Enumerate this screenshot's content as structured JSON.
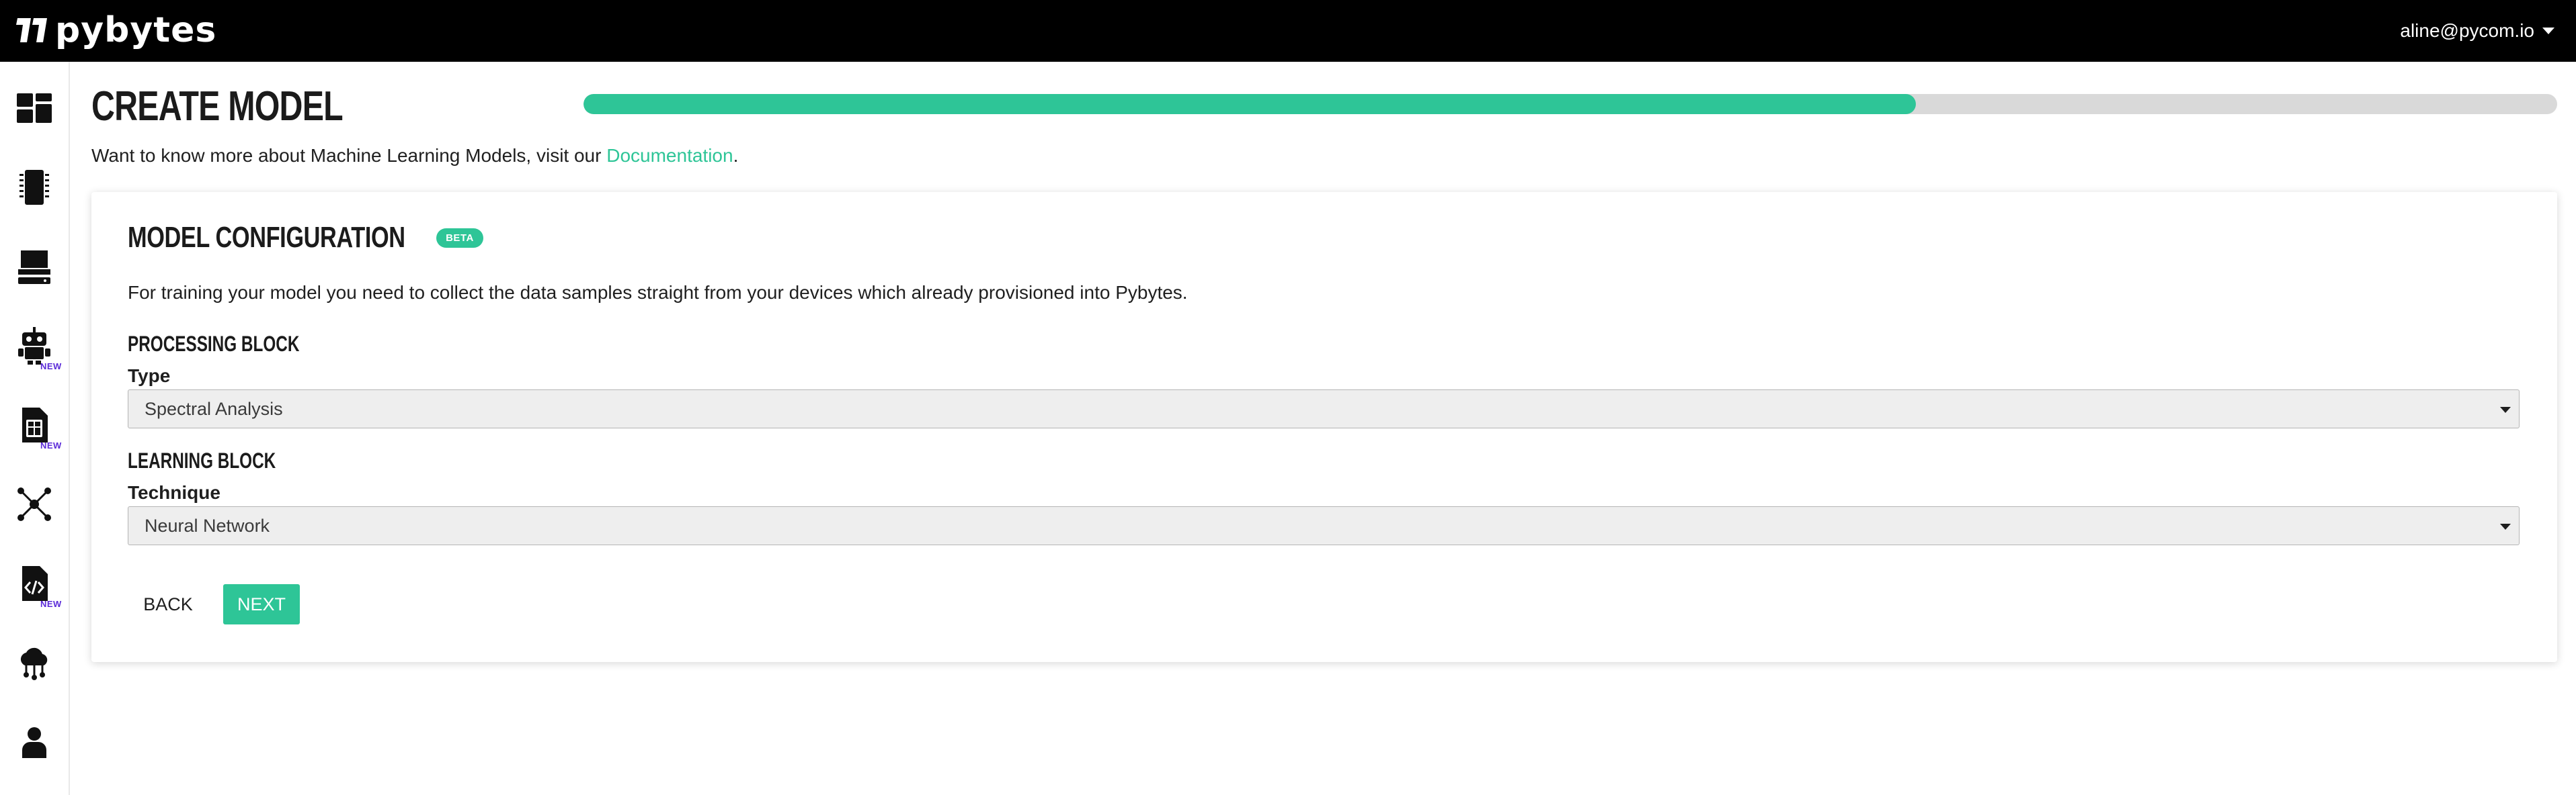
{
  "app": {
    "name": "pybytes",
    "user_email": "aline@pycom.io"
  },
  "colors": {
    "accent": "#2ec597",
    "topbar": "#000000",
    "new_badge": "#5b2bd8"
  },
  "sidebar": {
    "items": [
      {
        "icon": "dashboard-icon",
        "badge": ""
      },
      {
        "icon": "device-chip-icon",
        "badge": ""
      },
      {
        "icon": "server-icon",
        "badge": ""
      },
      {
        "icon": "robot-icon",
        "badge": "NEW"
      },
      {
        "icon": "sim-card-icon",
        "badge": "NEW"
      },
      {
        "icon": "network-nodes-icon",
        "badge": ""
      },
      {
        "icon": "code-file-icon",
        "badge": "NEW"
      },
      {
        "icon": "cloud-integration-icon",
        "badge": ""
      },
      {
        "icon": "user-account-icon",
        "badge": ""
      }
    ]
  },
  "page": {
    "title": "CREATE MODEL",
    "progress_percent": 67.5,
    "intro_text": "Want to know more about Machine Learning Models, visit our ",
    "intro_link": "Documentation",
    "intro_end": "."
  },
  "card": {
    "title": "MODEL CONFIGURATION",
    "badge": "BETA",
    "description": "For training your model you need to collect the data samples straight from your devices which already provisioned into Pybytes.",
    "processing_block": {
      "title": "PROCESSING BLOCK",
      "label": "Type",
      "value": "Spectral Analysis"
    },
    "learning_block": {
      "title": "LEARNING BLOCK",
      "label": "Technique",
      "value": "Neural Network"
    },
    "back_label": "BACK",
    "next_label": "NEXT"
  }
}
